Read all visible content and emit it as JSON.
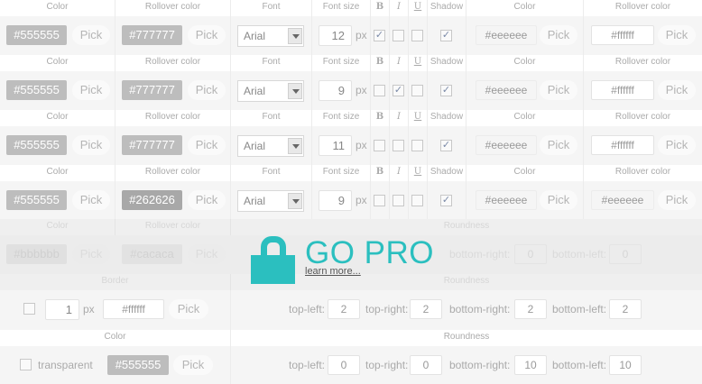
{
  "headers": {
    "color": "Color",
    "rollover_color": "Rollover color",
    "font": "Font",
    "font_size": "Font size",
    "bold": "B",
    "italic": "I",
    "underline": "U",
    "shadow": "Shadow",
    "border": "Border",
    "roundness": "Roundness"
  },
  "pick_label": "Pick",
  "px_label": "px",
  "font_rows": [
    {
      "color": "#555555",
      "rollover": "#777777",
      "font": "Arial",
      "size": "12",
      "bold": true,
      "italic": false,
      "underline": false,
      "shadow": true,
      "shadow_color": "#eeeeee",
      "shadow_rollover": "#ffffff"
    },
    {
      "color": "#555555",
      "rollover": "#777777",
      "font": "Arial",
      "size": "9",
      "bold": false,
      "italic": true,
      "underline": false,
      "shadow": true,
      "shadow_color": "#eeeeee",
      "shadow_rollover": "#ffffff"
    },
    {
      "color": "#555555",
      "rollover": "#777777",
      "font": "Arial",
      "size": "11",
      "bold": false,
      "italic": false,
      "underline": false,
      "shadow": true,
      "shadow_color": "#eeeeee",
      "shadow_rollover": "#ffffff"
    },
    {
      "color": "#555555",
      "rollover": "#262626",
      "font": "Arial",
      "size": "9",
      "bold": false,
      "italic": false,
      "underline": false,
      "shadow": true,
      "shadow_color": "#eeeeee",
      "shadow_rollover": "#eeeeee"
    }
  ],
  "swatch_colors": {
    "row_color_bg": "#bdbdbd",
    "row_rollover_bg": "#bdbdbd",
    "row4_rollover_bg": "#a8a8a8",
    "bg_bbbbbb": "#d9d9d9",
    "bg_cacaca": "#dddddd",
    "bg_555555": "#bdbdbd"
  },
  "pro_section": {
    "color_value": "#bbbbbb",
    "rollover_value": "#cacaca",
    "bottom_right_label": "bottom-right:",
    "bottom_right_value": "0",
    "bottom_left_label": "bottom-left:",
    "bottom_left_value": "0",
    "title": "GO PRO",
    "link": "learn more...",
    "accent": "#2bbfbf"
  },
  "border_row": {
    "enabled": false,
    "width": "1",
    "color": "#ffffff",
    "top_left_label": "top-left:",
    "top_left": "2",
    "top_right_label": "top-right:",
    "top_right": "2",
    "bottom_right_label": "bottom-right:",
    "bottom_right": "2",
    "bottom_left_label": "bottom-left:",
    "bottom_left": "2"
  },
  "background_row": {
    "transparent": false,
    "transparent_label": "transparent",
    "color": "#555555",
    "top_left_label": "top-left:",
    "top_left": "0",
    "top_right_label": "top-right:",
    "top_right": "0",
    "bottom_right_label": "bottom-right:",
    "bottom_right": "10",
    "bottom_left_label": "bottom-left:",
    "bottom_left": "10"
  }
}
